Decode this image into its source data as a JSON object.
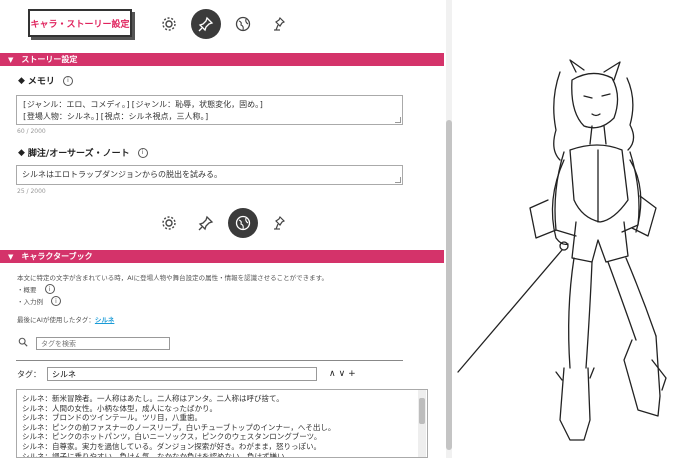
{
  "header": {
    "tab_label": "キャラ・ストーリー設定",
    "icons": [
      "gear-icon",
      "pin-icon",
      "globe-icon",
      "stand-pin-icon"
    ]
  },
  "story": {
    "section_title": "ストーリー設定",
    "memo_label": "メモリ",
    "memo_text": "[ジャンル：エロ、コメディ。][ジャンル：恥辱，状態変化，固め。]\n[登場人物：シルネ。][視点：シルネ視点，三人称。]",
    "memo_counter": "60 / 2000",
    "note_label": "脚注/オーサーズ・ノート",
    "note_text": "シルネはエロトラップダンジョンからの脱出を試みる。",
    "note_counter": "25 / 2000"
  },
  "chara": {
    "section_title": "キャラクターブック",
    "description": "本文に特定の文字が含まれている時，AIに登場人物や舞台設定の属性・情報を認識させることができます。",
    "bullet1": "・概要",
    "bullet2": "・入力例",
    "last_used_prefix": "最後にAIが使用したタグ：",
    "last_used_tag": "シルネ",
    "search_placeholder": "タグを検索",
    "tag_label": "タグ：",
    "tag_value": "シルネ",
    "tag_controls": "∧∨+",
    "entry_text": "シルネ：新米冒険者。一人称はあたし。二人称はアンタ。二人称は呼び捨て。\nシルネ：人間の女性。小柄な体型，成人になったばかり。\nシルネ：ブロンドのツインテール。ツリ目，八重歯。\nシルネ：ピンクの前ファスナーのノースリーブ，白いチューブトップのインナー，へそ出し。\nシルネ：ピンクのホットパンツ，白いニーソックス，ピンクのウェスタンロングブーツ。\nシルネ：自尊家。実力を過信している。ダンジョン探索が好き。わがまま，怒りっぽい。\nシルネ：調子に乗りやすい，負けん気，なかなか負けを認めない，負けず嫌い。"
  },
  "colors": {
    "accent": "#d4336a",
    "link": "#1a9bd7"
  }
}
